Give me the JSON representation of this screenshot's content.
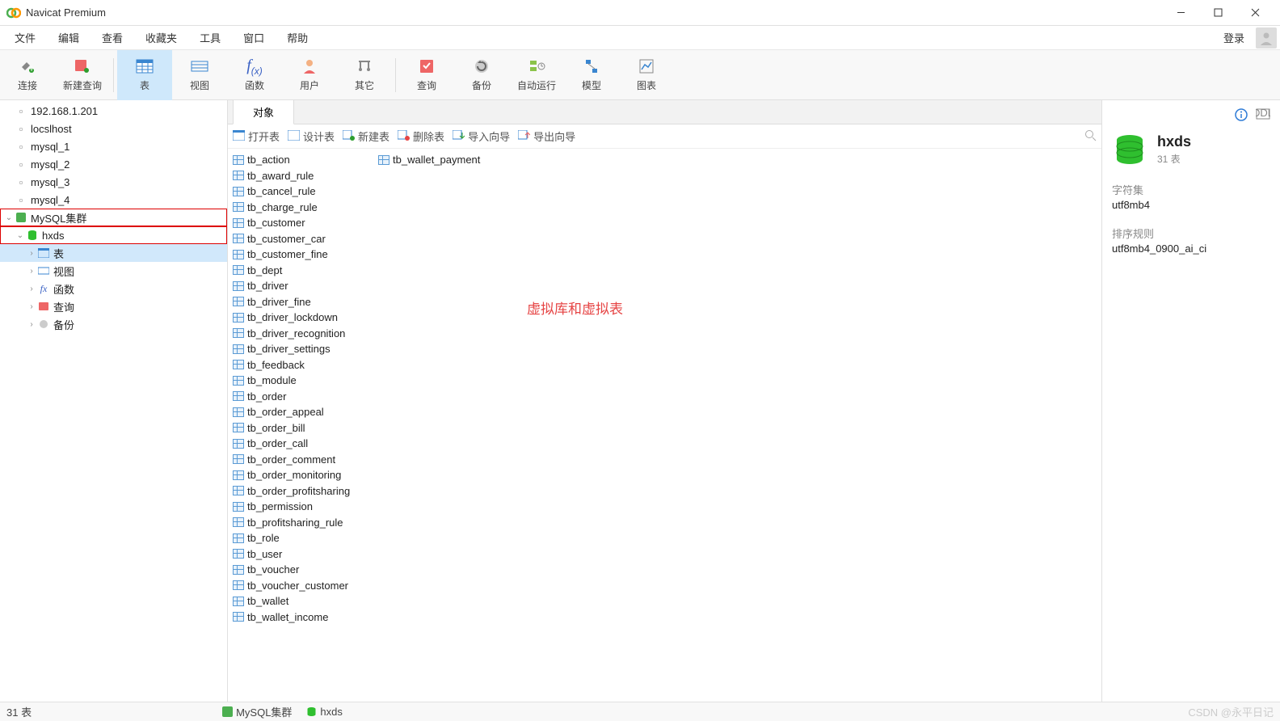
{
  "title": "Navicat Premium",
  "menubar": {
    "items": [
      "文件",
      "编辑",
      "查看",
      "收藏夹",
      "工具",
      "窗口",
      "帮助"
    ],
    "login": "登录"
  },
  "toolbar": {
    "items": [
      {
        "label": "连接",
        "icon": "plug"
      },
      {
        "label": "新建查询",
        "icon": "newquery"
      },
      {
        "label": "表",
        "icon": "table",
        "active": true
      },
      {
        "label": "视图",
        "icon": "view"
      },
      {
        "label": "函数",
        "icon": "fx"
      },
      {
        "label": "用户",
        "icon": "user"
      },
      {
        "label": "其它",
        "icon": "wrench"
      },
      {
        "label": "查询",
        "icon": "query"
      },
      {
        "label": "备份",
        "icon": "backup"
      },
      {
        "label": "自动运行",
        "icon": "auto"
      },
      {
        "label": "模型",
        "icon": "model"
      },
      {
        "label": "图表",
        "icon": "chart"
      }
    ]
  },
  "sidebar": {
    "connections": [
      "192.168.1.201",
      "locslhost",
      "mysql_1",
      "mysql_2",
      "mysql_3",
      "mysql_4"
    ],
    "cluster": "MySQL集群",
    "database": "hxds",
    "children": [
      "表",
      "视图",
      "函数",
      "查询",
      "备份"
    ]
  },
  "tab_label": "对象",
  "subbar": {
    "open": "打开表",
    "design": "设计表",
    "new": "新建表",
    "delete": "删除表",
    "import": "导入向导",
    "export": "导出向导"
  },
  "tables": [
    "tb_action",
    "tb_award_rule",
    "tb_cancel_rule",
    "tb_charge_rule",
    "tb_customer",
    "tb_customer_car",
    "tb_customer_fine",
    "tb_dept",
    "tb_driver",
    "tb_driver_fine",
    "tb_driver_lockdown",
    "tb_driver_recognition",
    "tb_driver_settings",
    "tb_feedback",
    "tb_module",
    "tb_order",
    "tb_order_appeal",
    "tb_order_bill",
    "tb_order_call",
    "tb_order_comment",
    "tb_order_monitoring",
    "tb_order_profitsharing",
    "tb_permission",
    "tb_profitsharing_rule",
    "tb_role",
    "tb_user",
    "tb_voucher",
    "tb_voucher_customer",
    "tb_wallet",
    "tb_wallet_income",
    "tb_wallet_payment"
  ],
  "annotation": "虚拟库和虚拟表",
  "rightpanel": {
    "dbname": "hxds",
    "count": "31 表",
    "charset_label": "字符集",
    "charset": "utf8mb4",
    "collation_label": "排序规则",
    "collation": "utf8mb4_0900_ai_ci"
  },
  "statusbar": {
    "count": "31 表",
    "cluster": "MySQL集群",
    "db": "hxds",
    "watermark": "CSDN @永平日记"
  }
}
